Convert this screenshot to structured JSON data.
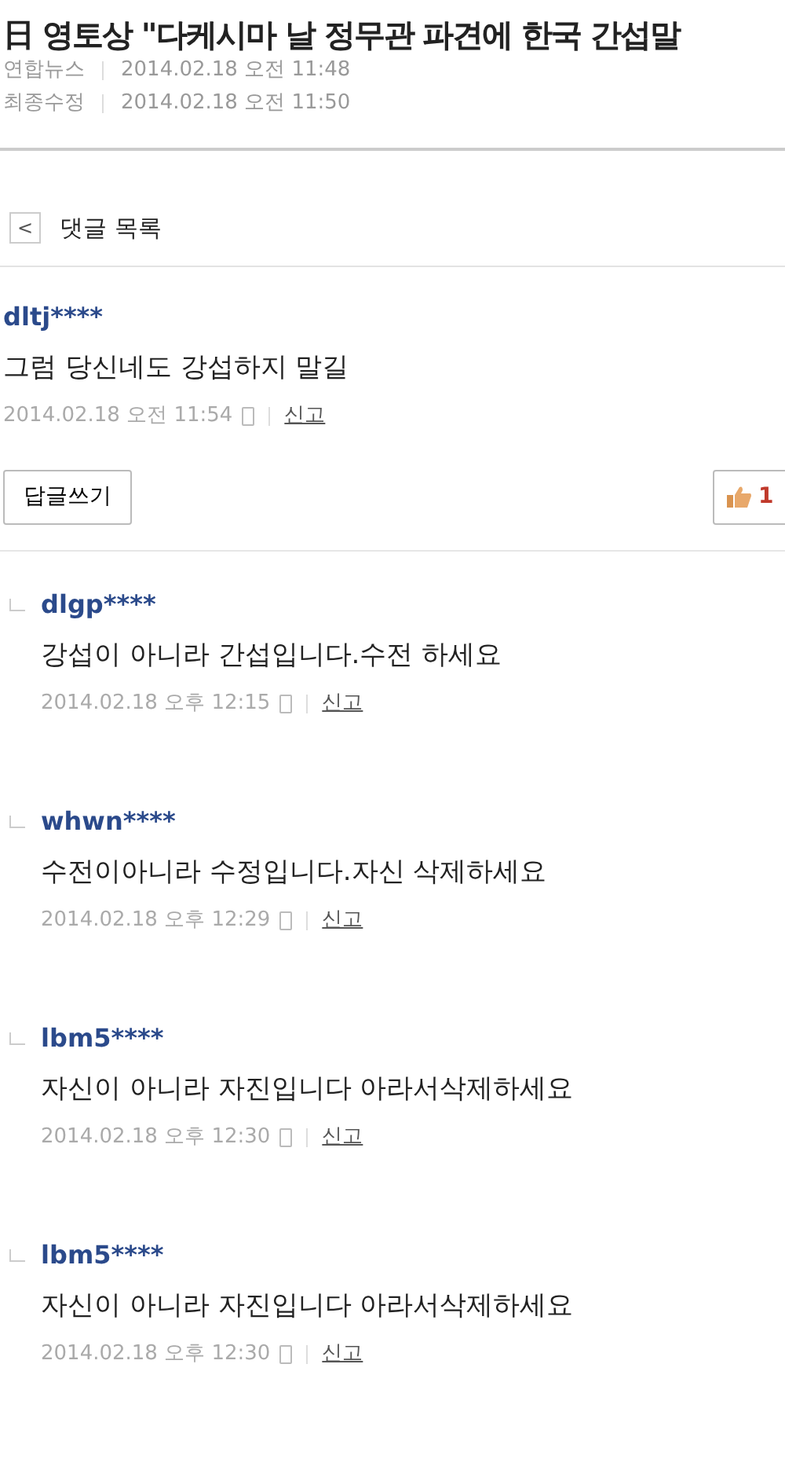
{
  "article": {
    "title": "日 영토상 \"다케시마 날 정무관 파견에 한국 간섭말",
    "meta": [
      {
        "label": "연합뉴스",
        "value": "2014.02.18 오전 11:48"
      },
      {
        "label": "최종수정",
        "value": "2014.02.18 오전 11:50"
      }
    ]
  },
  "back_bar": {
    "icon": "<",
    "label": "댓글 목록"
  },
  "comment": {
    "user": "dltj****",
    "text": "그럼 당신네도 강섭하지 말길",
    "time": "2014.02.18 오전 11:54",
    "report": "신고",
    "reply_button": "답글쓰기",
    "likes": "1"
  },
  "replies": [
    {
      "user": "dlgp****",
      "text": "강섭이 아니라 간섭입니다.수전 하세요",
      "time": "2014.02.18 오후 12:15",
      "report": "신고"
    },
    {
      "user": "whwn****",
      "text": "수전이아니라 수정입니다.자신 삭제하세요",
      "time": "2014.02.18 오후 12:29",
      "report": "신고"
    },
    {
      "user": "lbm5****",
      "text": "자신이 아니라 자진입니다 아라서삭제하세요",
      "time": "2014.02.18 오후 12:30",
      "report": "신고"
    },
    {
      "user": "lbm5****",
      "text": "자신이 아니라 자진입니다 아라서삭제하세요",
      "time": "2014.02.18 오후 12:30",
      "report": "신고"
    }
  ]
}
